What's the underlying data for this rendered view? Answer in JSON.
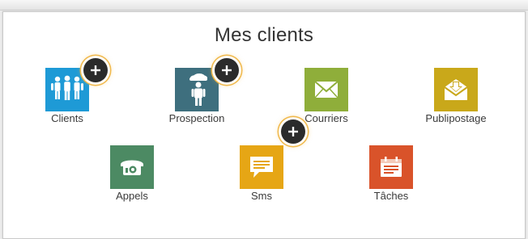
{
  "page": {
    "title": "Mes clients"
  },
  "tiles": [
    {
      "label": "Clients",
      "color": "#1e9ad6",
      "icon": "users-group-icon"
    },
    {
      "label": "Prospection",
      "color": "#3e6f7e",
      "icon": "person-cloud-icon"
    },
    {
      "label": "Courriers",
      "color": "#8fae3a",
      "icon": "envelope-icon"
    },
    {
      "label": "Publipostage",
      "color": "#c9a81a",
      "icon": "mail-download-icon"
    },
    {
      "label": "Appels",
      "color": "#4c8a63",
      "icon": "telephone-icon"
    },
    {
      "label": "Sms",
      "color": "#e6a615",
      "icon": "chat-bubble-icon"
    },
    {
      "label": "Tâches",
      "color": "#d9532a",
      "icon": "calendar-task-icon"
    }
  ],
  "add_buttons": [
    {
      "icon": "plus-icon"
    },
    {
      "icon": "plus-icon"
    },
    {
      "icon": "plus-icon"
    }
  ]
}
